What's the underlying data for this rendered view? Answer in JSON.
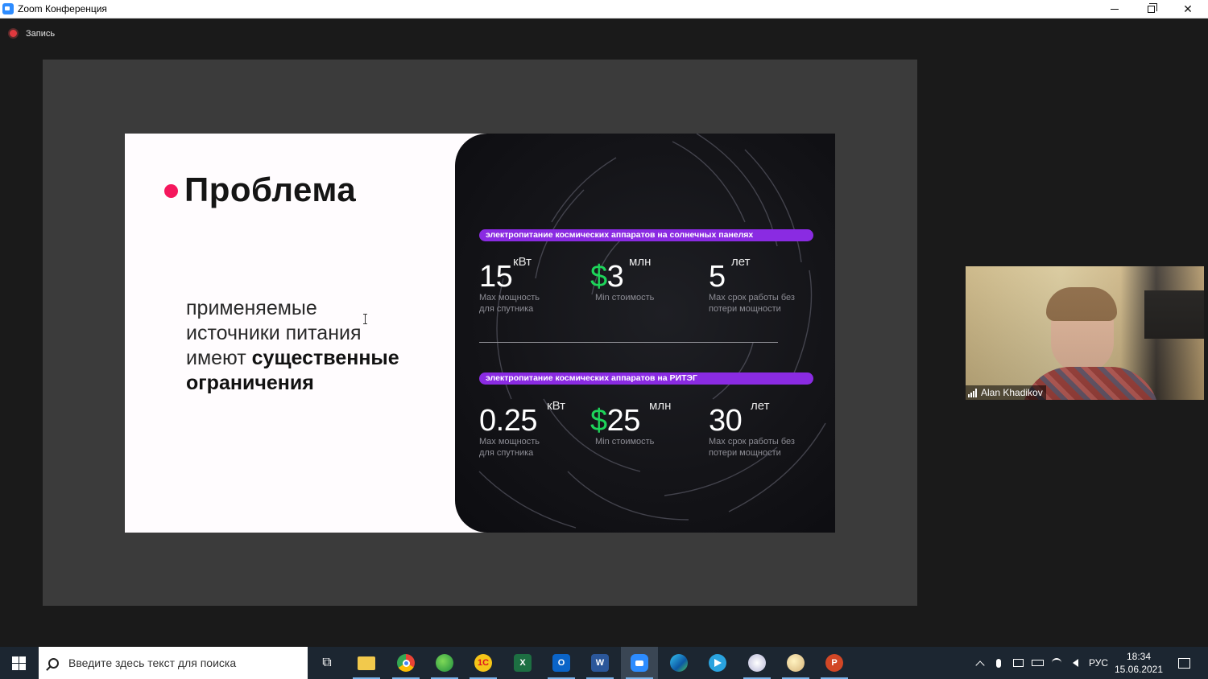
{
  "window": {
    "title": "Zoom Конференция",
    "controls": {
      "minimize": "minimize",
      "maximize": "maximize",
      "close": "✕"
    }
  },
  "recording": {
    "label": "Запись",
    "color": "#e0393e"
  },
  "slide": {
    "title": "Проблема",
    "accent_color": "#f5175d",
    "body_line1": "применяемые",
    "body_line2": "источники питания",
    "body_line3_regular": "имеют ",
    "body_line3_bold": "существенные",
    "body_line4_bold": "ограничения",
    "panel": {
      "pill_color": "#8a2be2",
      "section1": {
        "label": "электропитание космических аппаратов на солнечных панелях",
        "stats": [
          {
            "value": "15",
            "unit": "кВт",
            "desc_line1": "Max мощность",
            "desc_line2": "для спутника",
            "dollar": ""
          },
          {
            "value": "3",
            "unit": "млн",
            "desc_line1": "Min стоимость",
            "desc_line2": "",
            "dollar": "$"
          },
          {
            "value": "5",
            "unit": "лет",
            "desc_line1": "Max срок работы без",
            "desc_line2": "потери мощности",
            "dollar": ""
          }
        ]
      },
      "section2": {
        "label": "электропитание космических аппаратов на РИТЭГ",
        "stats": [
          {
            "value": "0.25",
            "unit": "кВт",
            "desc_line1": "Max мощность",
            "desc_line2": "для спутника",
            "dollar": ""
          },
          {
            "value": "25",
            "unit": "млн",
            "desc_line1": "Min стоимость",
            "desc_line2": "",
            "dollar": "$"
          },
          {
            "value": "30",
            "unit": "лет",
            "desc_line1": "Max срок работы без",
            "desc_line2": "потери мощности",
            "dollar": ""
          }
        ]
      }
    }
  },
  "participant": {
    "name": "Alan Khadikov",
    "icon": "signal-bars-icon"
  },
  "taskbar": {
    "search_placeholder": "Введите здесь текст для поиска",
    "apps": [
      {
        "name": "task-view",
        "glyph": "⧉",
        "color": ""
      },
      {
        "name": "file-explorer",
        "glyph": "",
        "color": "#f2c94c"
      },
      {
        "name": "chrome",
        "glyph": "",
        "color": "#ea4335"
      },
      {
        "name": "maps",
        "glyph": "",
        "color": "#34a853"
      },
      {
        "name": "1c",
        "glyph": "1С",
        "color": "#f5a623"
      },
      {
        "name": "excel",
        "glyph": "X",
        "color": "#1d6f42"
      },
      {
        "name": "outlook",
        "glyph": "O",
        "color": "#0a64c8"
      },
      {
        "name": "word",
        "glyph": "W",
        "color": "#2b579a"
      },
      {
        "name": "zoom",
        "glyph": "",
        "color": "#2d8cff"
      },
      {
        "name": "edge",
        "glyph": "",
        "color": "#1b9de2"
      },
      {
        "name": "telegram",
        "glyph": "",
        "color": "#2aa3df"
      },
      {
        "name": "app-rocket",
        "glyph": "",
        "color": "#d8d8e8"
      },
      {
        "name": "paint",
        "glyph": "",
        "color": "#e8d6a8"
      },
      {
        "name": "powerpoint",
        "glyph": "P",
        "color": "#d24726"
      }
    ],
    "tray": {
      "lang": "РУС",
      "time": "18:34",
      "date": "15.06.2021"
    }
  }
}
